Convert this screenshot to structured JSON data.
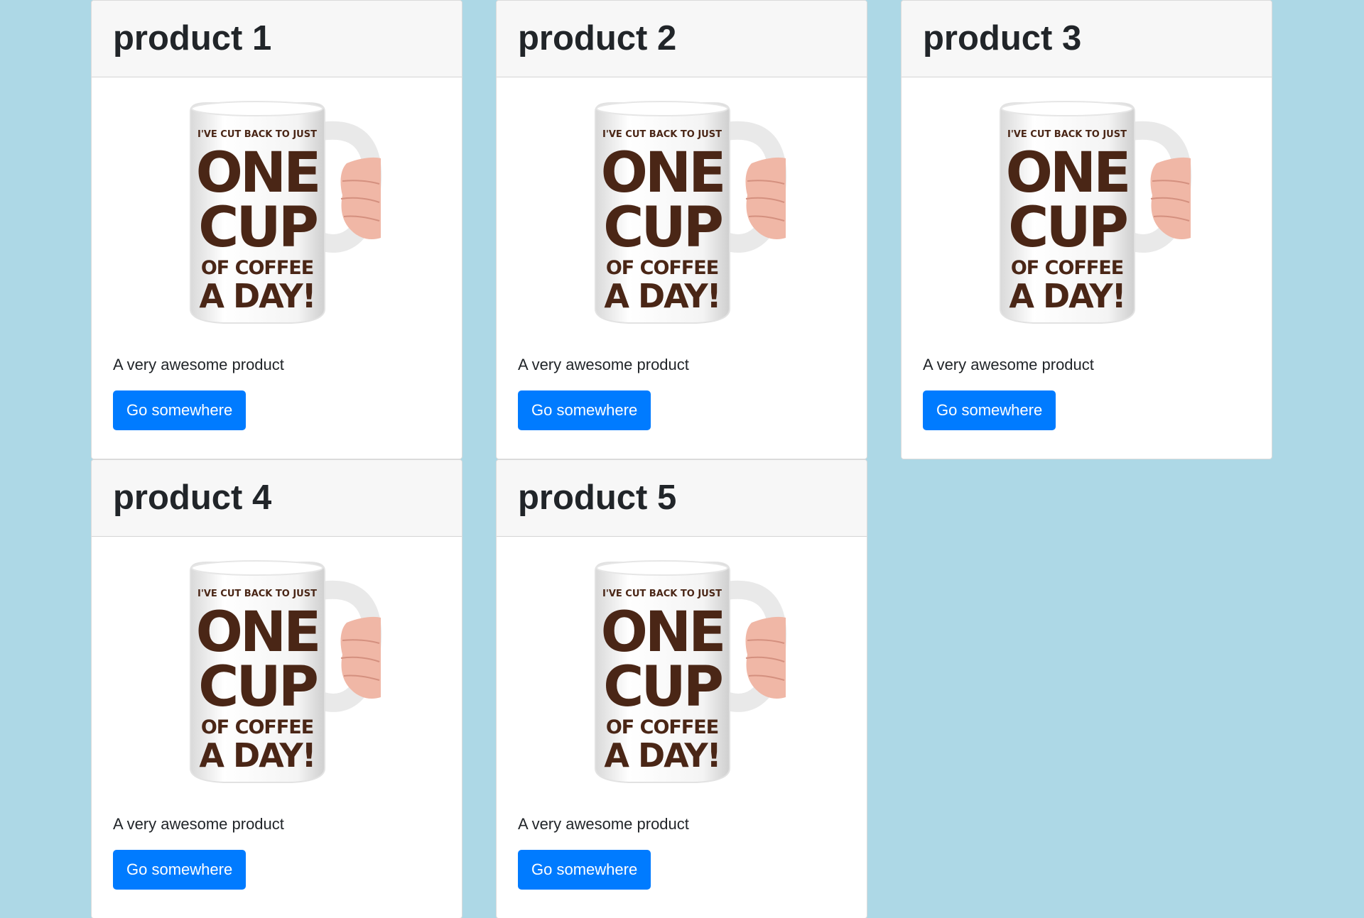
{
  "colors": {
    "background": "#add8e6",
    "button": "#007bff",
    "header_bg": "#f7f7f7",
    "mug_text": "#4a2616"
  },
  "mug_lines": [
    "I'VE CUT BACK TO JUST",
    "ONE",
    "CUP",
    "OF COFFEE",
    "A DAY!"
  ],
  "products": [
    {
      "title": "product 1",
      "description": "A very awesome product",
      "button": "Go somewhere"
    },
    {
      "title": "product 2",
      "description": "A very awesome product",
      "button": "Go somewhere"
    },
    {
      "title": "product 3",
      "description": "A very awesome product",
      "button": "Go somewhere"
    },
    {
      "title": "product 4",
      "description": "A very awesome product",
      "button": "Go somewhere"
    },
    {
      "title": "product 5",
      "description": "A very awesome product",
      "button": "Go somewhere"
    }
  ]
}
